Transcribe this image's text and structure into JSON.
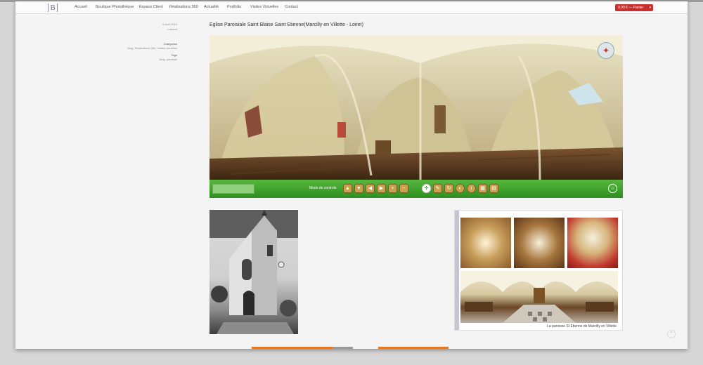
{
  "navbar": {
    "logo": "B",
    "items": [
      "Accueil",
      "Boutique Photothèque",
      "Espace Client",
      "Réalisations 360",
      "Actualité",
      "Portfolio",
      "Visites Virtuelles",
      "Contact"
    ],
    "cart": {
      "label": "0,00 € — Panier"
    }
  },
  "post": {
    "date": "6 avril 2014",
    "author": "Laurent",
    "categories_heading": "Catégories",
    "categories": "Blog, Réalisations 360, Visites virtuelles",
    "tags_heading": "Tags",
    "tags": "blog, paroisse",
    "title": "Eglise Paroisiale Saint Blaise Saint Etienne(Marcilly en Villette - Loiret)"
  },
  "viewer": {
    "control_label": "Mode de controle",
    "control_icons": [
      "move-up-icon",
      "move-down-icon",
      "move-left-icon",
      "move-right-icon",
      "zoom-in-icon",
      "zoom-out-icon"
    ],
    "mode_icons": [
      "compass-mode-icon",
      "edit-icon",
      "refresh-icon",
      "fullscreen-icon",
      "info-icon",
      "map-icon",
      "thumbnails-icon"
    ]
  },
  "collage": {
    "caption": "La paroisse St Etienne de Marcilly en Villette"
  },
  "colors": {
    "accent": "#c8302e",
    "viewer_bar": "#3a9a2a",
    "footer": "#e07a28"
  }
}
